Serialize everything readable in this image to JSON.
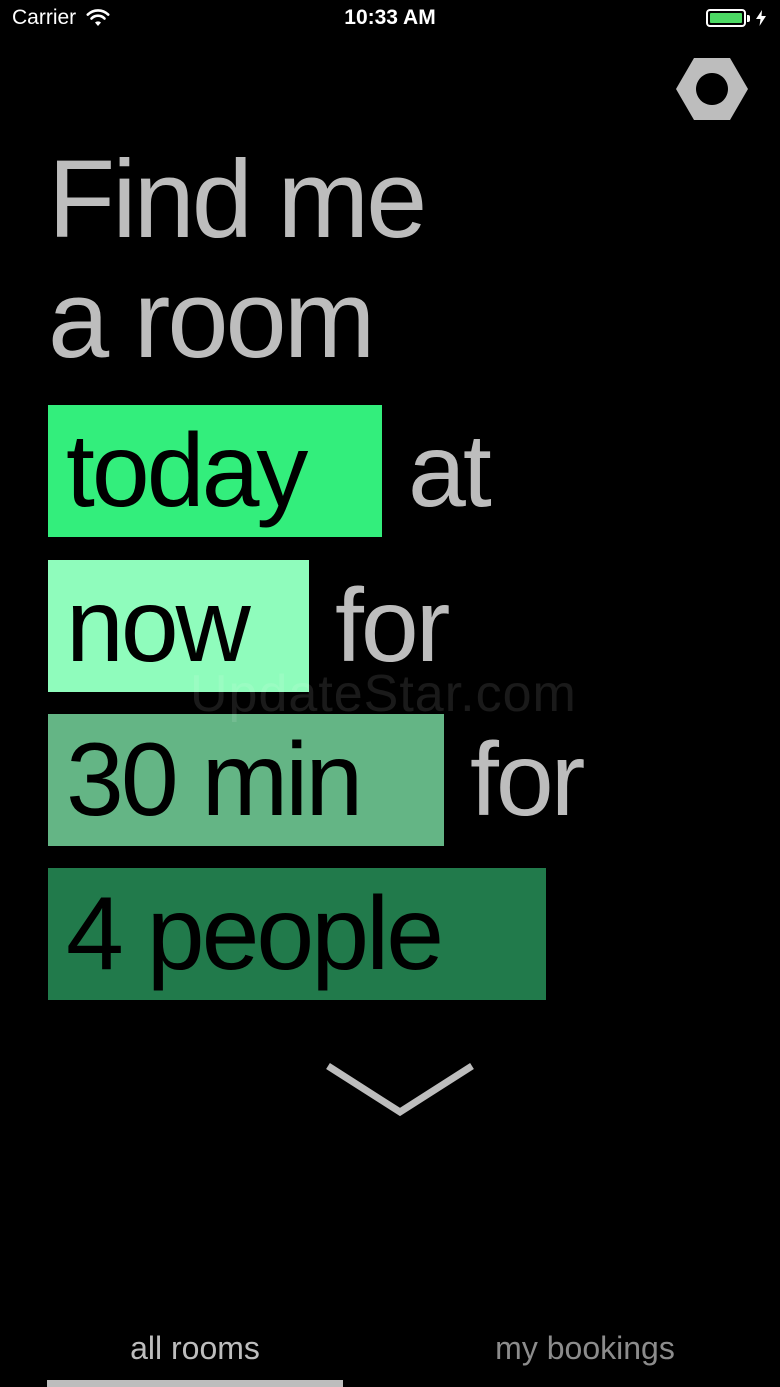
{
  "status_bar": {
    "carrier": "Carrier",
    "time": "10:33 AM",
    "battery_level": 1.0,
    "battery_color": "#4cd964"
  },
  "header": {
    "settings_icon": "hexagon-nut-icon"
  },
  "headline": {
    "line1": "Find me",
    "line2": "a room"
  },
  "query": {
    "day": {
      "label": "today",
      "connector": "at",
      "color": "#33ee7c"
    },
    "start": {
      "label": "now",
      "connector": "for",
      "color": "#8ffcbc"
    },
    "duration": {
      "label": "30 min",
      "connector": "for",
      "color": "#64b585"
    },
    "attendees": {
      "label": "4 people",
      "color": "#217a4b"
    }
  },
  "watermark": "UpdateStar.com",
  "expand_icon": "chevron-down-icon",
  "tabs": [
    {
      "label": "all rooms",
      "active": true
    },
    {
      "label": "my bookings",
      "active": false
    }
  ],
  "colors": {
    "background": "#000000",
    "text": "#bdbdbd"
  }
}
